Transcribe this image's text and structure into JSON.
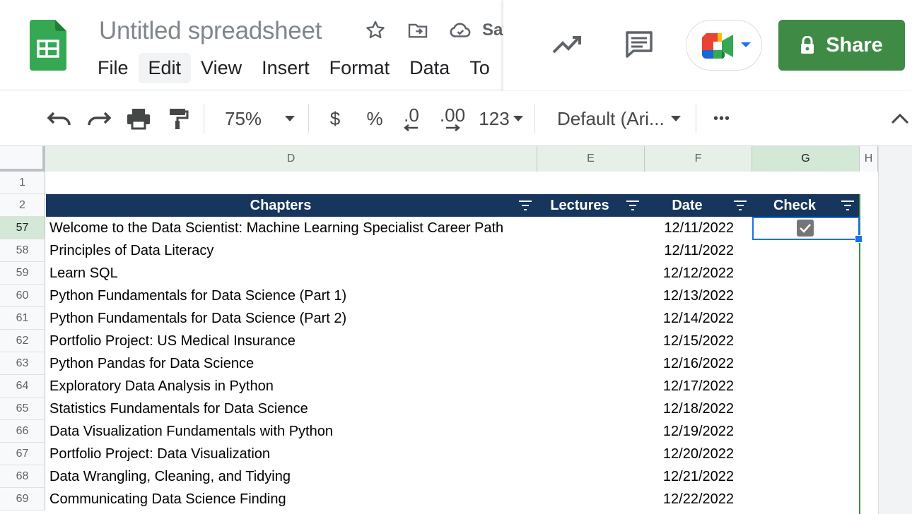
{
  "document": {
    "title": "Untitled spreadsheet",
    "save_status": "Sav"
  },
  "menu": [
    "File",
    "Edit",
    "View",
    "Insert",
    "Format",
    "Data",
    "To"
  ],
  "share": {
    "label": "Share"
  },
  "toolbar": {
    "zoom": "75%",
    "currency": "$",
    "percent": "%",
    "decrease_decimal": ".0",
    "increase_decimal": ".00",
    "number_format": "123",
    "font": "Default (Ari...",
    "more": "•••"
  },
  "columns": [
    "D",
    "E",
    "F",
    "G",
    "H"
  ],
  "table_header": {
    "chapters": "Chapters",
    "lectures": "Lectures",
    "date": "Date",
    "check": "Check"
  },
  "row_numbers": {
    "empty_row": "1",
    "header_row": "2"
  },
  "rows": [
    {
      "num": "57",
      "chapter": "Welcome to the Data Scientist: Machine Learning Specialist Career Path",
      "date": "12/11/2022",
      "checked": true
    },
    {
      "num": "58",
      "chapter": "Principles of Data Literacy",
      "date": "12/11/2022",
      "checked": false
    },
    {
      "num": "59",
      "chapter": "Learn SQL",
      "date": "12/12/2022",
      "checked": false
    },
    {
      "num": "60",
      "chapter": "Python Fundamentals for Data Science (Part 1)",
      "date": "12/13/2022",
      "checked": false
    },
    {
      "num": "61",
      "chapter": "Python Fundamentals for Data Science (Part 2)",
      "date": "12/14/2022",
      "checked": false
    },
    {
      "num": "62",
      "chapter": "Portfolio Project: US Medical Insurance",
      "date": "12/15/2022",
      "checked": false
    },
    {
      "num": "63",
      "chapter": "Python Pandas for Data Science",
      "date": "12/16/2022",
      "checked": false
    },
    {
      "num": "64",
      "chapter": "Exploratory Data Analysis in Python",
      "date": "12/17/2022",
      "checked": false
    },
    {
      "num": "65",
      "chapter": "Statistics Fundamentals for Data Science",
      "date": "12/18/2022",
      "checked": false
    },
    {
      "num": "66",
      "chapter": "Data Visualization Fundamentals with Python",
      "date": "12/19/2022",
      "checked": false
    },
    {
      "num": "67",
      "chapter": "Portfolio Project: Data Visualization",
      "date": "12/20/2022",
      "checked": false
    },
    {
      "num": "68",
      "chapter": "Data Wrangling, Cleaning, and Tidying",
      "date": "12/21/2022",
      "checked": false
    },
    {
      "num": "69",
      "chapter": "Communicating Data Science Finding",
      "date": "12/22/2022",
      "checked": false
    }
  ],
  "colors": {
    "header_band": "#17365d",
    "share_button": "#3f8b46",
    "selection": "#1a73e8",
    "table_border": "#3d8c40"
  }
}
